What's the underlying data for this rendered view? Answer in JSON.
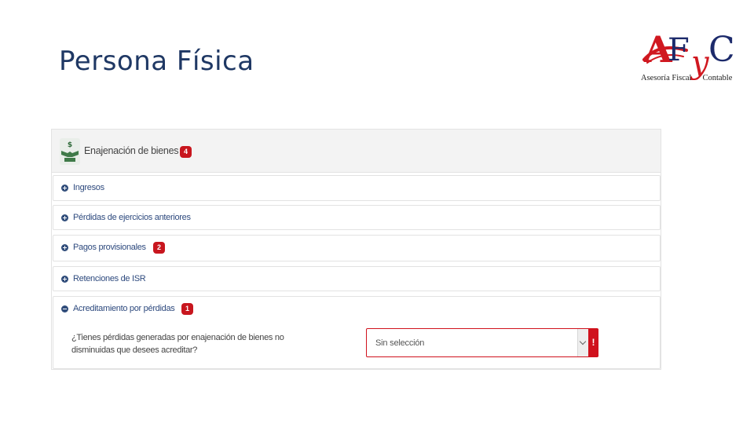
{
  "slide": {
    "title": "Persona Física"
  },
  "logo": {
    "letter_a": "A",
    "letter_f": "F",
    "letter_y": "y",
    "letter_c": "C",
    "subtitle_left": "Asesoría Fiscal",
    "subtitle_right": "Contable",
    "colors": {
      "red": "#d01820",
      "navy": "#1c2a6b"
    }
  },
  "panel": {
    "title": "Enajenación de bienes",
    "badge": "4",
    "icon": "money-handshake-icon",
    "items": [
      {
        "label": "Ingresos",
        "expanded": false,
        "badge": ""
      },
      {
        "label": "Pérdidas de ejercicios anteriores",
        "expanded": false,
        "badge": ""
      },
      {
        "label": "Pagos provisionales",
        "expanded": false,
        "badge": "2"
      },
      {
        "label": "Retenciones de ISR",
        "expanded": false,
        "badge": ""
      },
      {
        "label": "Acreditamiento por pérdidas",
        "expanded": true,
        "badge": "1"
      }
    ],
    "question": {
      "line1": "¿Tienes pérdidas generadas por enajenación de bienes no",
      "line2": "disminuidas que desees acreditar?"
    },
    "select": {
      "value": "Sin selección",
      "alert": "!"
    }
  },
  "colors": {
    "accent_red": "#c8161e",
    "link_blue": "#2e4a7e",
    "title_navy": "#1f3864"
  }
}
